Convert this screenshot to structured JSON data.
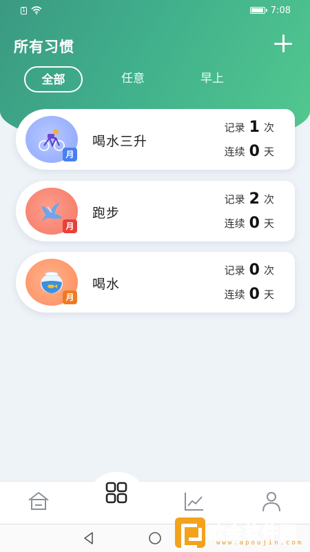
{
  "status_bar": {
    "time": "7:08",
    "sim_label": "1"
  },
  "header": {
    "title": "所有习惯",
    "add_icon": "plus-icon"
  },
  "tabs": [
    {
      "label": "全部",
      "active": true
    },
    {
      "label": "任意",
      "active": false
    },
    {
      "label": "早上",
      "active": false
    }
  ],
  "habits": [
    {
      "name": "喝水三升",
      "badge": "月",
      "records_label": "记录",
      "records_count": "1",
      "records_unit": "次",
      "streak_label": "连续",
      "streak_count": "0",
      "streak_unit": "天",
      "icon": "cycling-icon"
    },
    {
      "name": "跑步",
      "badge": "月",
      "records_label": "记录",
      "records_count": "2",
      "records_unit": "次",
      "streak_label": "连续",
      "streak_count": "0",
      "streak_unit": "天",
      "icon": "bird-icon"
    },
    {
      "name": "喝水",
      "badge": "月",
      "records_label": "记录",
      "records_count": "0",
      "records_unit": "次",
      "streak_label": "连续",
      "streak_count": "0",
      "streak_unit": "天",
      "icon": "fishbowl-icon"
    }
  ],
  "bottom_nav": {
    "items": [
      "home-icon",
      "grid-icon",
      "chart-icon",
      "profile-icon"
    ],
    "active": "grid-icon"
  },
  "watermark": {
    "text": "欧金软件园",
    "url": "www.apoujin.com"
  },
  "colors": {
    "header_start": "#3a9a82",
    "header_end": "#53c98f",
    "background": "#eef3f8"
  }
}
